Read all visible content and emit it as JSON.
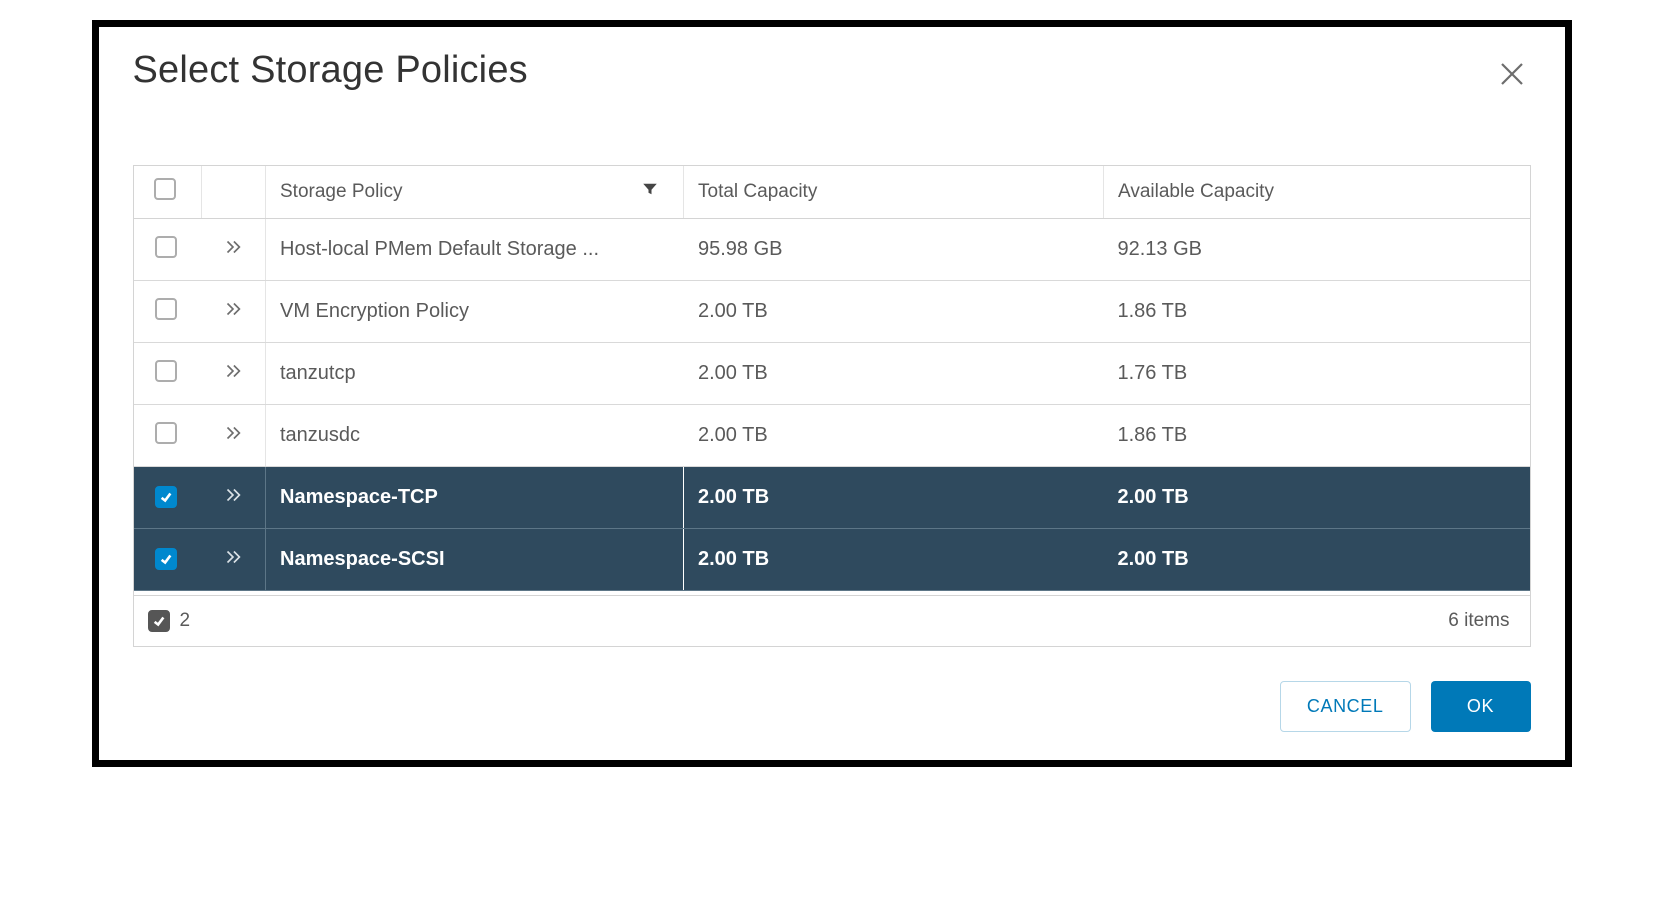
{
  "dialog": {
    "title": "Select Storage Policies"
  },
  "table": {
    "headers": {
      "policy": "Storage Policy",
      "total": "Total Capacity",
      "available": "Available Capacity"
    },
    "rows": [
      {
        "selected": false,
        "policy": "Host-local PMem Default Storage ...",
        "total": "95.98 GB",
        "available": "92.13 GB"
      },
      {
        "selected": false,
        "policy": "VM Encryption Policy",
        "total": "2.00 TB",
        "available": "1.86 TB"
      },
      {
        "selected": false,
        "policy": "tanzutcp",
        "total": "2.00 TB",
        "available": "1.76 TB"
      },
      {
        "selected": false,
        "policy": "tanzusdc",
        "total": "2.00 TB",
        "available": "1.86 TB"
      },
      {
        "selected": true,
        "policy": "Namespace-TCP",
        "total": "2.00 TB",
        "available": "2.00 TB"
      },
      {
        "selected": true,
        "policy": "Namespace-SCSI",
        "total": "2.00 TB",
        "available": "2.00 TB"
      }
    ]
  },
  "footer": {
    "selected_count": "2",
    "items_label": "6 items"
  },
  "buttons": {
    "cancel": "CANCEL",
    "ok": "OK"
  }
}
